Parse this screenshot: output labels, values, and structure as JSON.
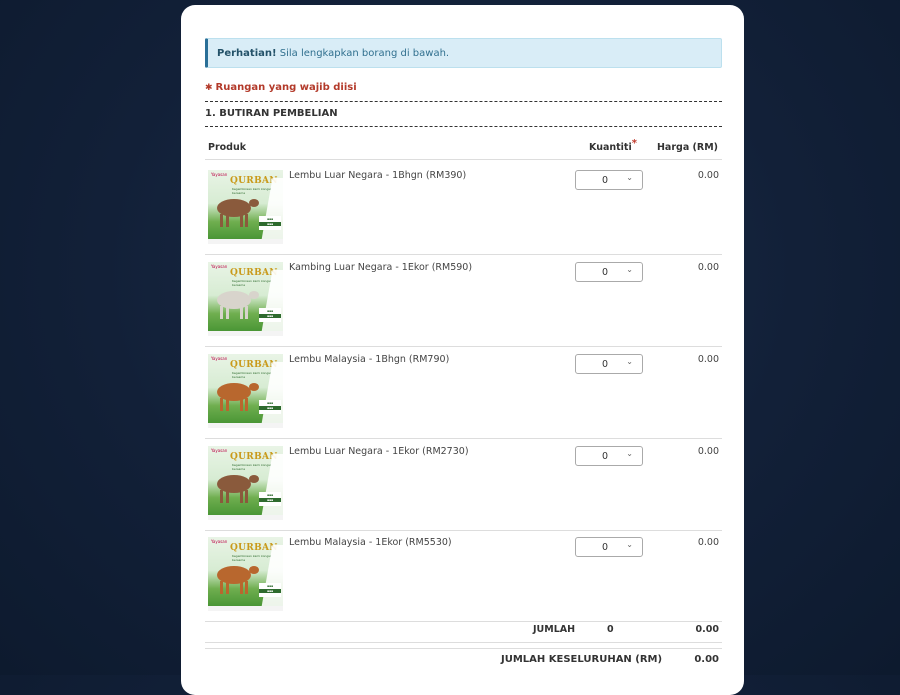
{
  "alert": {
    "title": "Perhatian!",
    "message": "Sila lengkapkan borang di bawah."
  },
  "required_note": "Ruangan yang wajib diisi",
  "section": {
    "title": "1. BUTIRAN PEMBELIAN"
  },
  "table": {
    "headers": {
      "product": "Produk",
      "quantity": "Kuantiti",
      "price": "Harga (RM)"
    },
    "rows": [
      {
        "name": "Lembu Luar Negara - 1Bhgn (RM390)",
        "quantity": "0",
        "price": "0.00",
        "animal": "cow-brown-icon"
      },
      {
        "name": "Kambing Luar Negara - 1Ekor (RM590)",
        "quantity": "0",
        "price": "0.00",
        "animal": "goat-white-icon"
      },
      {
        "name": "Lembu Malaysia - 1Bhgn (RM790)",
        "quantity": "0",
        "price": "0.00",
        "animal": "cow-orange-icon"
      },
      {
        "name": "Lembu Luar Negara - 1Ekor (RM2730)",
        "quantity": "0",
        "price": "0.00",
        "animal": "cow-brown-icon"
      },
      {
        "name": "Lembu Malaysia - 1Ekor (RM5530)",
        "quantity": "0",
        "price": "0.00",
        "animal": "cow-orange-icon"
      }
    ],
    "thumb": {
      "brand": "Yayasan",
      "title": "QURBAN",
      "sub": "Kegembiraan kami kongsi bersama"
    },
    "total": {
      "label": "JUMLAH",
      "quantity": "0",
      "price": "0.00"
    },
    "grand_total": {
      "label": "JUMLAH KESELURUHAN (RM)",
      "price": "0.00"
    }
  },
  "colors": {
    "background": "#122038",
    "alert_bg": "#d9edf7",
    "required": "#b33a2a"
  }
}
